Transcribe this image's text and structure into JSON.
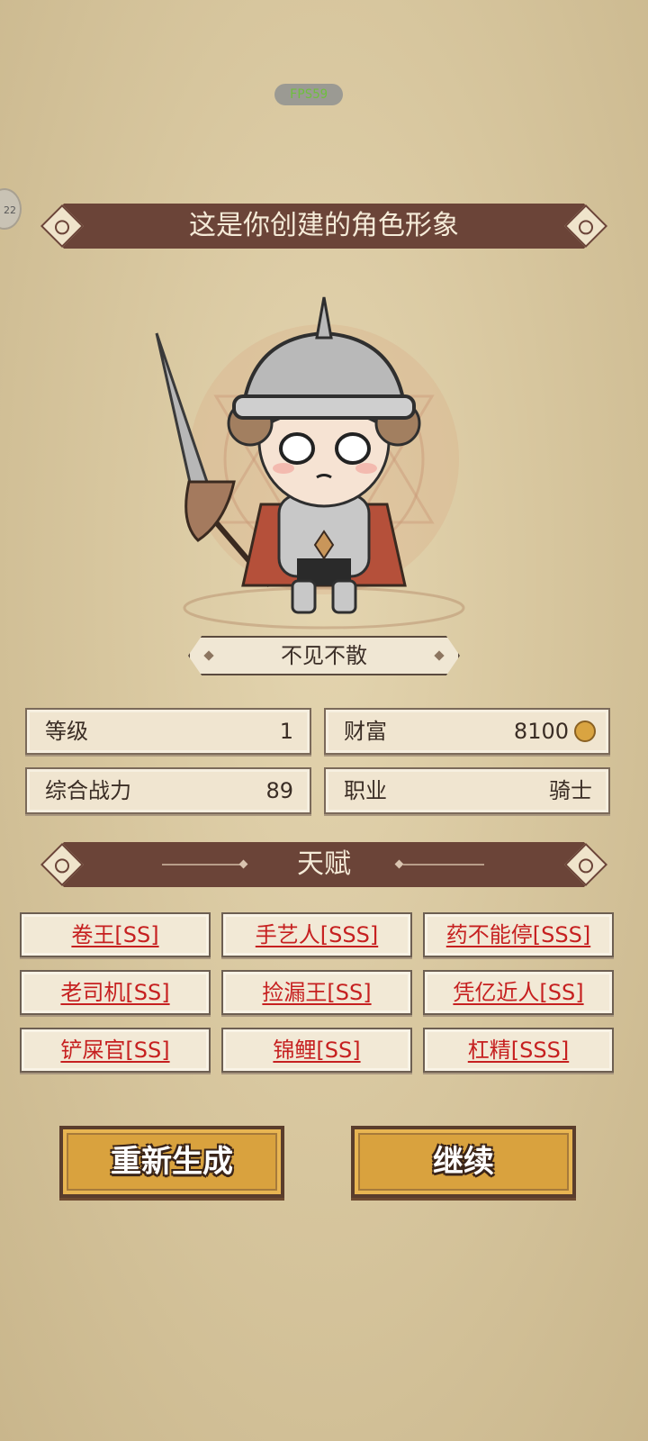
{
  "hud": {
    "fps": "FPS59",
    "side_tab": "22"
  },
  "header": {
    "title": "这是你创建的角色形象"
  },
  "character": {
    "name": "不见不散"
  },
  "stats": [
    {
      "label": "等级",
      "value": "1"
    },
    {
      "label": "财富",
      "value": "8100",
      "icon": "coin-icon"
    },
    {
      "label": "综合战力",
      "value": "89"
    },
    {
      "label": "职业",
      "value": "骑士"
    }
  ],
  "talents": {
    "title": "天赋",
    "items": [
      "卷王[SS]",
      "手艺人[SSS]",
      "药不能停[SSS]",
      "老司机[SS]",
      "捡漏王[SS]",
      "凭亿近人[SS]",
      "铲屎官[SS]",
      "锦鲤[SS]",
      "杠精[SSS]"
    ]
  },
  "buttons": {
    "regenerate": "重新生成",
    "continue": "继续"
  },
  "colors": {
    "ribbon": "#6b4438",
    "talent_text": "#c62020",
    "button": "#d9a23e"
  }
}
